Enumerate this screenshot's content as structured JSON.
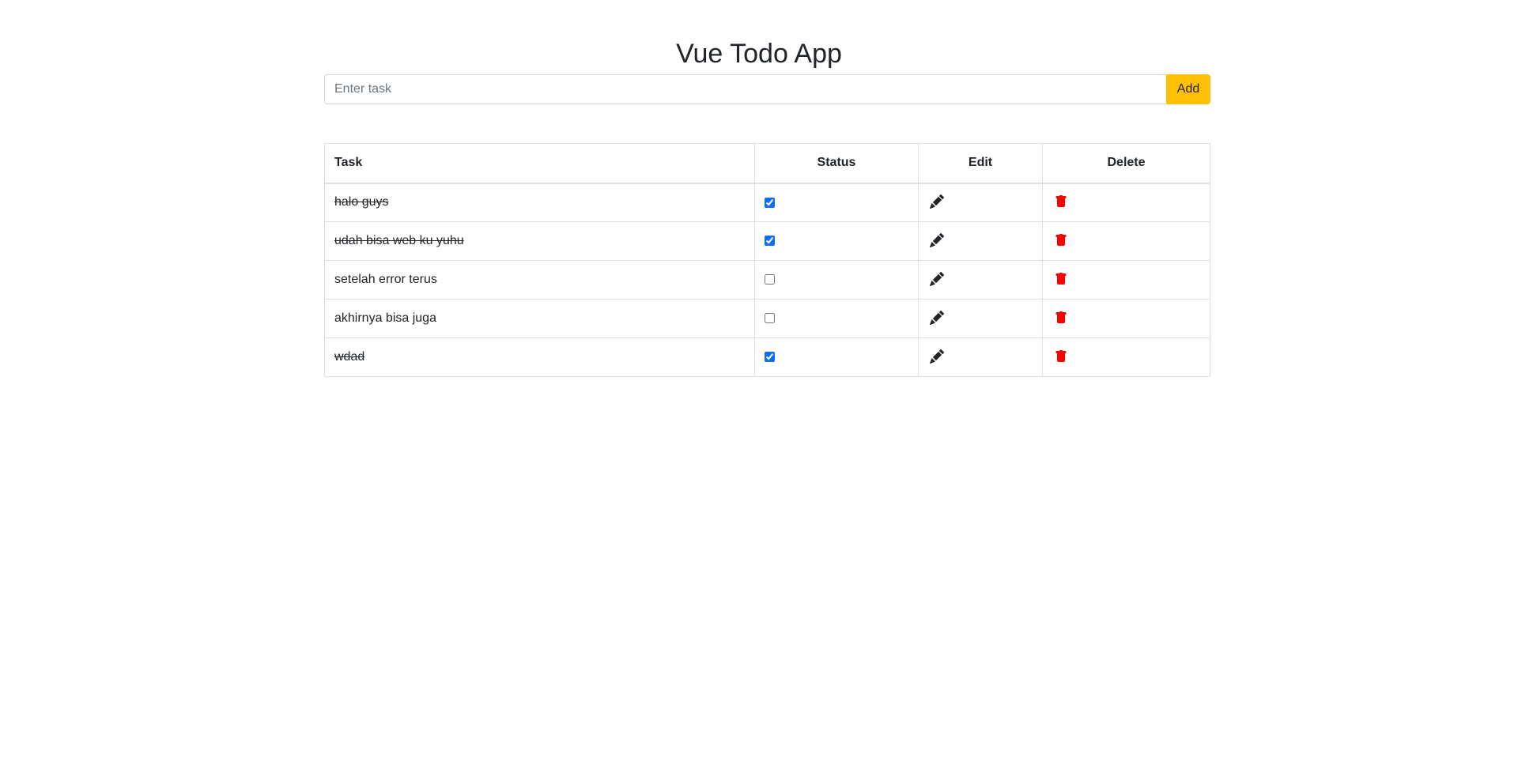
{
  "app": {
    "title": "Vue Todo App"
  },
  "form": {
    "input_value": "",
    "placeholder": "Enter task",
    "add_label": "Add"
  },
  "table": {
    "headers": {
      "task": "Task",
      "status": "Status",
      "edit": "Edit",
      "delete": "Delete"
    },
    "rows": [
      {
        "task": "halo guys",
        "done": true
      },
      {
        "task": "udah bisa web ku yuhu",
        "done": true
      },
      {
        "task": "setelah error terus",
        "done": false
      },
      {
        "task": "akhirnya bisa juga",
        "done": false
      },
      {
        "task": "wdad",
        "done": true
      }
    ]
  },
  "icons": {
    "edit": "pencil-icon",
    "delete": "trash-icon"
  },
  "colors": {
    "add_button": "#ffc107",
    "delete_icon": "#ff0000",
    "edit_icon": "#212529",
    "checkbox": "#0d6efd"
  }
}
